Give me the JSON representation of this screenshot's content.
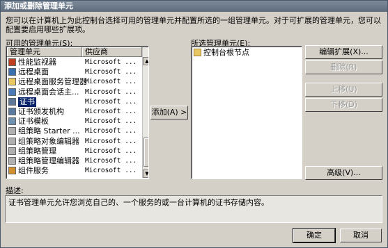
{
  "window": {
    "title": "添加或删除管理单元"
  },
  "intro": "您可以在计算机上为此控制台选择可用的管理单元并配置所选的一组管理单元。对于可扩展的管理单元，您可以配置要启用哪些扩展项。",
  "available": {
    "label": "可用的管理单元(S):",
    "col_name": "管理单元",
    "col_vendor": "供应商",
    "items": [
      {
        "name": "性能监视器",
        "vendor": "Microsoft ...",
        "icon": "performance-icon",
        "color": "#c04020"
      },
      {
        "name": "远程桌面",
        "vendor": "Microsoft ...",
        "icon": "remote-desktop-icon",
        "color": "#3a6fb0"
      },
      {
        "name": "远程桌面服务管理器",
        "vendor": "Microsoft ...",
        "icon": "folder-icon",
        "color": "#e8c860"
      },
      {
        "name": "远程桌面会话主...",
        "vendor": "Microsoft ...",
        "icon": "session-host-icon",
        "color": "#4a7ab8"
      },
      {
        "name": "证书",
        "vendor": "Microsoft ...",
        "icon": "certificate-icon",
        "color": "#607898",
        "selected": true
      },
      {
        "name": "证书颁发机构",
        "vendor": "Microsoft ...",
        "icon": "cert-authority-icon",
        "color": "#5a7aa0"
      },
      {
        "name": "证书模板",
        "vendor": "Microsoft ...",
        "icon": "cert-template-icon",
        "color": "#7090b0"
      },
      {
        "name": "组策略 Starter ...",
        "vendor": "Microsoft ...",
        "icon": "policy-icon",
        "color": "#b0b0b0"
      },
      {
        "name": "组策略对象编辑器",
        "vendor": "Microsoft ...",
        "icon": "policy-editor-icon",
        "color": "#b0b0b0"
      },
      {
        "name": "组策略管理",
        "vendor": "Microsoft ...",
        "icon": "policy-mgmt-icon",
        "color": "#b0b0b0"
      },
      {
        "name": "组策略管理编辑器",
        "vendor": "Microsoft ...",
        "icon": "policy-mgmt-editor-icon",
        "color": "#b0b0b0"
      },
      {
        "name": "组件服务",
        "vendor": "Microsoft ...",
        "icon": "component-services-icon",
        "color": "#d09030"
      }
    ]
  },
  "add_button": "添加(A) >",
  "selected": {
    "label": "所选管理单元(E):",
    "items": [
      {
        "name": "控制台根节点",
        "icon": "folder-icon"
      }
    ]
  },
  "buttons": {
    "edit_extensions": "编辑扩展(X)...",
    "remove": "删除(R)",
    "move_up": "上移(U)",
    "move_down": "下移(D)",
    "advanced": "高级(V)...",
    "ok": "确定",
    "cancel": "取消"
  },
  "description": {
    "label": "描述:",
    "text": "证书管理单元允许您浏览自己的、一个服务的或一台计算机的证书存储内容。"
  }
}
